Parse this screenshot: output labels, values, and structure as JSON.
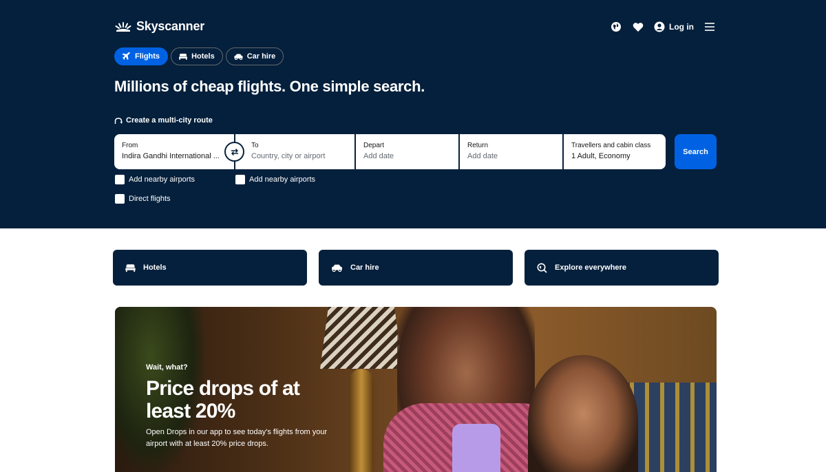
{
  "brand": {
    "name": "Skyscanner"
  },
  "header": {
    "login_label": "Log in",
    "icons": [
      "globe-icon",
      "heart-icon",
      "user-icon",
      "menu-icon"
    ]
  },
  "tabs": [
    {
      "label": "Flights",
      "icon": "plane-icon",
      "active": true
    },
    {
      "label": "Hotels",
      "icon": "bed-icon",
      "active": false
    },
    {
      "label": "Car hire",
      "icon": "car-icon",
      "active": false
    }
  ],
  "headline": "Millions of cheap flights. One simple search.",
  "multicity_label": "Create a multi-city route",
  "search": {
    "from": {
      "label": "From",
      "value": "Indira Gandhi International ..."
    },
    "to": {
      "label": "To",
      "placeholder": "Country, city or airport"
    },
    "depart": {
      "label": "Depart",
      "placeholder": "Add date"
    },
    "return": {
      "label": "Return",
      "placeholder": "Add date"
    },
    "travellers": {
      "label": "Travellers and cabin class",
      "value": "1 Adult, Economy"
    },
    "button_label": "Search"
  },
  "options": {
    "nearby_from": "Add nearby airports",
    "nearby_to": "Add nearby airports",
    "direct": "Direct flights"
  },
  "quick_links": [
    {
      "label": "Hotels",
      "icon": "bed-icon"
    },
    {
      "label": "Car hire",
      "icon": "car-icon"
    },
    {
      "label": "Explore everywhere",
      "icon": "explore-icon"
    }
  ],
  "banner": {
    "eyebrow": "Wait, what?",
    "title": "Price drops of at least 20%",
    "description": "Open Drops in our app to see today's flights from your airport with at least 20% price drops."
  },
  "colors": {
    "navy": "#05203c",
    "blue": "#0062e3",
    "white": "#ffffff"
  }
}
